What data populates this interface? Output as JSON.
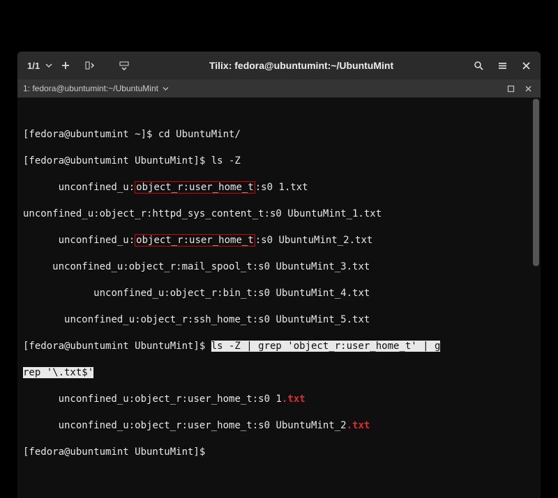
{
  "titlebar": {
    "session": "1/1",
    "title": "Tilix: fedora@ubuntumint:~/UbuntuMint"
  },
  "tab": {
    "label": "1: fedora@ubuntumint:~/UbuntuMint"
  },
  "prompts": {
    "home": "[fedora@ubuntumint ~]$ ",
    "dir": "[fedora@ubuntumint UbuntuMint]$ "
  },
  "commands": {
    "cd": "cd UbuntuMint/",
    "lsz": "ls -Z",
    "grep": "ls -Z | grep 'object_r:user_home_t' | grep '\\.txt$'"
  },
  "ls_output": [
    {
      "indent": "      ",
      "pre": "unconfined_u:",
      "boxed": "object_r:user_home_t",
      "post": ":s0 1.txt"
    },
    {
      "indent": "",
      "pre": "unconfined_u:object_r:httpd_sys_content_t:s0 UbuntuMint_1.txt",
      "boxed": "",
      "post": ""
    },
    {
      "indent": "      ",
      "pre": "unconfined_u:",
      "boxed": "object_r:user_home_t",
      "post": ":s0 UbuntuMint_2.txt"
    },
    {
      "indent": "     ",
      "pre": "unconfined_u:object_r:mail_spool_t:s0 UbuntuMint_3.txt",
      "boxed": "",
      "post": ""
    },
    {
      "indent": "            ",
      "pre": "unconfined_u:object_r:bin_t:s0 UbuntuMint_4.txt",
      "boxed": "",
      "post": ""
    },
    {
      "indent": "       ",
      "pre": "unconfined_u:object_r:ssh_home_t:s0 UbuntuMint_5.txt",
      "boxed": "",
      "post": ""
    }
  ],
  "grep_output": [
    {
      "indent": "      ",
      "ctx": "unconfined_u:object_r:user_home_t:s0 1",
      "match": ".txt"
    },
    {
      "indent": "      ",
      "ctx": "unconfined_u:object_r:user_home_t:s0 UbuntuMint_2",
      "match": ".txt"
    }
  ]
}
